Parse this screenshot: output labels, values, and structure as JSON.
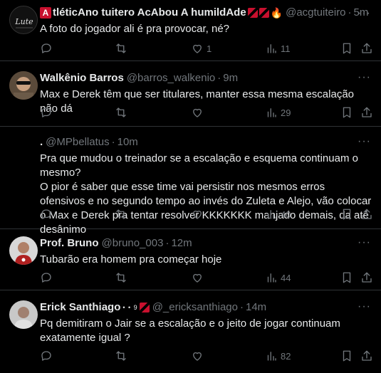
{
  "tweets": [
    {
      "name": "AtléticAno tuitero AcAbou A humildAde",
      "name_prefix": "A",
      "name_rest": "tléticAno tuitero AcAbou A humildAde",
      "handle": "@acgtuiteiro",
      "time": "5m",
      "text": "A foto do jogador ali é pra provocar, né?",
      "likes": "1",
      "views": "11",
      "avatar_label": "Lute"
    },
    {
      "name": "Walkênio Barros",
      "handle": "@barros_walkenio",
      "time": "9m",
      "text": "Max e Derek têm que ser titulares, manter essa mesma escalação não dá",
      "likes": "",
      "views": "29"
    },
    {
      "name": ".",
      "handle": "@MPbellatus",
      "time": "10m",
      "text": "Pra que mudou o treinador se a escalação e esquema continuam o mesmo?\nO pior é saber que esse time vai persistir nos mesmos erros ofensivos e no segundo tempo ao invés do Zuleta e Alejo, vão colocar o Max e Derek pra tentar resolver KKKKKKK manjado demais, da até desânimo",
      "likes": "",
      "views": "40"
    },
    {
      "name": "Prof. Bruno",
      "handle": "@bruno_003",
      "time": "12m",
      "text": "Tubarão era homem pra começar hoje",
      "likes": "",
      "views": "44"
    },
    {
      "name": "Erick Santhiago",
      "name_suffix": "• • 9",
      "handle": "@_ericksanthiago",
      "time": "14m",
      "text": "Pq demitiram o Jair se a escalação e o jeito de jogar continuam exatamente igual ?",
      "likes": "",
      "views": "82"
    }
  ],
  "ui": {
    "separator": "·",
    "more": "···"
  },
  "colors": {
    "background": "#000000",
    "text": "#e7e9ea",
    "muted": "#71767b",
    "border": "#2f3336",
    "club_red": "#c8102e"
  },
  "icons": [
    "reply-icon",
    "retweet-icon",
    "like-icon",
    "views-icon",
    "bookmark-icon",
    "share-icon"
  ]
}
